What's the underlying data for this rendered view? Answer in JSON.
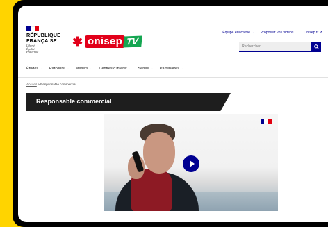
{
  "brand": {
    "rf_name_line1": "RÉPUBLIQUE",
    "rf_name_line2": "FRANÇAISE",
    "rf_motto_1": "Liberté",
    "rf_motto_2": "Égalité",
    "rf_motto_3": "Fraternité",
    "flag_colors": [
      "#000091",
      "#ffffff",
      "#e1000f"
    ],
    "logo_text": "onisep",
    "logo_suffix": "TV",
    "logo_red": "#e2001a",
    "logo_green": "#14a651"
  },
  "header": {
    "links": [
      "Équipe éducative →",
      "Proposez vos vidéos →",
      "Onisep.fr ↗"
    ],
    "search_placeholder": "Rechercher",
    "search_icon": "search-icon"
  },
  "nav": {
    "items": [
      "Études",
      "Parcours",
      "Métiers",
      "Centres d'intérêt",
      "Séries",
      "Partenaires"
    ]
  },
  "breadcrumb": {
    "home": "Accueil",
    "separator": ">",
    "current": "Responsable commercial"
  },
  "page": {
    "title": "Responsable commercial"
  },
  "video": {
    "play_icon": "play-icon"
  }
}
